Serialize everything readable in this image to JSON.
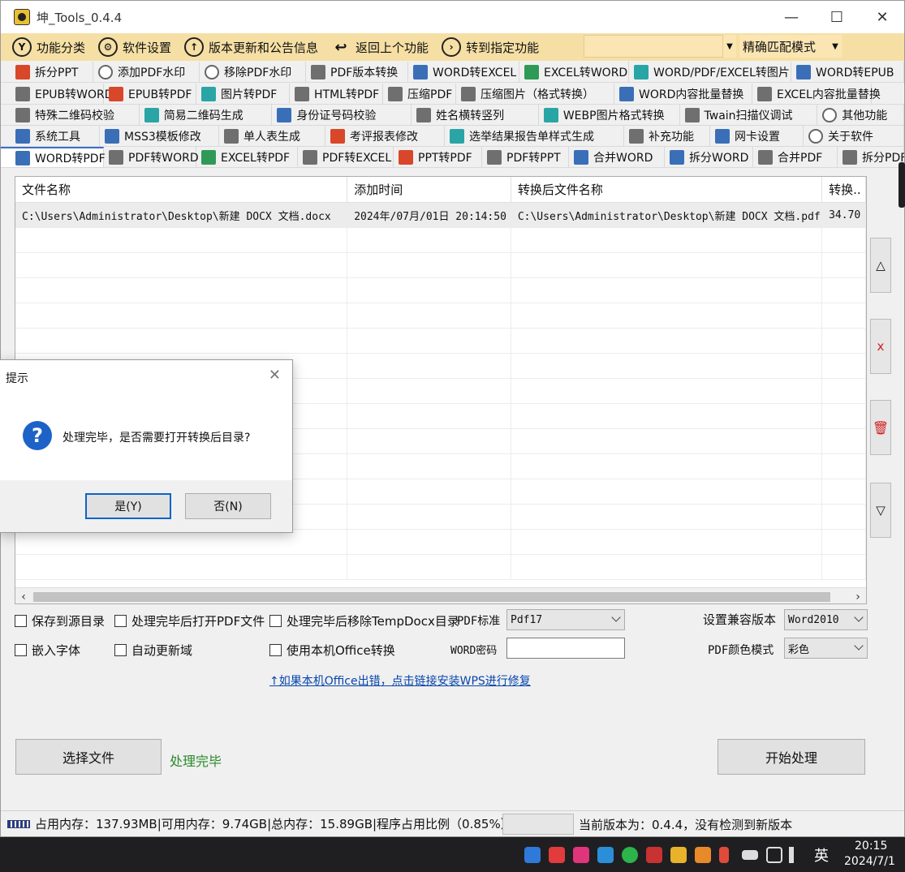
{
  "window": {
    "title": "坤_Tools_0.4.4",
    "minimize": "—",
    "maximize": "☐",
    "close": "✕"
  },
  "toolbar": {
    "items": [
      {
        "label": "功能分类",
        "icon": "Y"
      },
      {
        "label": "软件设置",
        "icon": "⚙"
      },
      {
        "label": "版本更新和公告信息",
        "icon": "↑"
      },
      {
        "label": "返回上个功能",
        "icon": "↩"
      },
      {
        "label": "转到指定功能",
        "icon": "›"
      }
    ],
    "search_value": "",
    "match_mode": "精确匹配模式"
  },
  "tab_rows": [
    [
      {
        "label": "拆分PPT",
        "icon": "ico-red"
      },
      {
        "label": "添加PDF水印",
        "icon": "ico-ring"
      },
      {
        "label": "移除PDF水印",
        "icon": "ico-ring"
      },
      {
        "label": "PDF版本转换",
        "icon": "ico-gray"
      },
      {
        "label": "WORD转EXCEL",
        "icon": "ico-blue"
      },
      {
        "label": "EXCEL转WORD",
        "icon": "ico-green"
      },
      {
        "label": "WORD/PDF/EXCEL转图片",
        "icon": "ico-teal"
      },
      {
        "label": "WORD转EPUB",
        "icon": "ico-blue"
      }
    ],
    [
      {
        "label": "EPUB转WORD",
        "icon": "ico-gray"
      },
      {
        "label": "EPUB转PDF",
        "icon": "ico-red"
      },
      {
        "label": "图片转PDF",
        "icon": "ico-teal"
      },
      {
        "label": "HTML转PDF",
        "icon": "ico-gray"
      },
      {
        "label": "压缩PDF",
        "icon": "ico-gray"
      },
      {
        "label": "压缩图片（格式转换）",
        "icon": "ico-gray"
      },
      {
        "label": "WORD内容批量替换",
        "icon": "ico-blue"
      },
      {
        "label": "EXCEL内容批量替换",
        "icon": "ico-gray"
      }
    ],
    [
      {
        "label": "特殊二维码校验",
        "icon": "ico-gray"
      },
      {
        "label": "简易二维码生成",
        "icon": "ico-teal"
      },
      {
        "label": "身份证号码校验",
        "icon": "ico-blue"
      },
      {
        "label": "姓名横转竖列",
        "icon": "ico-gray"
      },
      {
        "label": "WEBP图片格式转换",
        "icon": "ico-teal"
      },
      {
        "label": "Twain扫描仪调试",
        "icon": "ico-gray"
      },
      {
        "label": "其他功能",
        "icon": "ico-ring"
      }
    ],
    [
      {
        "label": "系统工具",
        "icon": "ico-blue"
      },
      {
        "label": "MSS3模板修改",
        "icon": "ico-blue"
      },
      {
        "label": "单人表生成",
        "icon": "ico-gray"
      },
      {
        "label": "考评报表修改",
        "icon": "ico-red"
      },
      {
        "label": "选举结果报告单样式生成",
        "icon": "ico-teal"
      },
      {
        "label": "补充功能",
        "icon": "ico-gray"
      },
      {
        "label": "网卡设置",
        "icon": "ico-blue"
      },
      {
        "label": "关于软件",
        "icon": "ico-ring"
      }
    ],
    [
      {
        "label": "WORD转PDF",
        "icon": "ico-blue"
      },
      {
        "label": "PDF转WORD",
        "icon": "ico-gray"
      },
      {
        "label": "EXCEL转PDF",
        "icon": "ico-green"
      },
      {
        "label": "PDF转EXCEL",
        "icon": "ico-gray"
      },
      {
        "label": "PPT转PDF",
        "icon": "ico-red"
      },
      {
        "label": "PDF转PPT",
        "icon": "ico-gray"
      },
      {
        "label": "合并WORD",
        "icon": "ico-blue"
      },
      {
        "label": "拆分WORD",
        "icon": "ico-blue"
      },
      {
        "label": "合并PDF",
        "icon": "ico-gray"
      },
      {
        "label": "拆分PDF",
        "icon": "ico-gray"
      }
    ]
  ],
  "grid": {
    "columns": [
      "文件名称",
      "添加时间",
      "转换后文件名称",
      "转换.."
    ],
    "rows": [
      [
        "C:\\Users\\Administrator\\Desktop\\新建 DOCX 文档.docx",
        "2024年/07月/01日 20:14:50",
        "C:\\Users\\Administrator\\Desktop\\新建 DOCX 文档.pdf",
        "34.70"
      ]
    ],
    "empty_rows": 14
  },
  "side_buttons": {
    "up": "△",
    "delete": "x",
    "clear": "🗑",
    "down": "▽"
  },
  "options": {
    "save_to_source": "保存到源目录",
    "open_pdf_after": "处理完毕后打开PDF文件",
    "remove_tempdocx": "处理完毕后移除TempDocx目录",
    "pdf_standard_label": "PDF标准",
    "pdf_standard_value": "Pdf17",
    "compat_label": "设置兼容版本",
    "compat_value": "Word2010",
    "embed_fonts": "嵌入字体",
    "auto_update_fields": "自动更新域",
    "use_local_office": "使用本机Office转换",
    "word_password_label": "WORD密码",
    "word_password_value": "",
    "pdf_color_label": "PDF颜色模式",
    "pdf_color_value": "彩色",
    "repair_link": "↑如果本机Office出错，点击链接安装WPS进行修复"
  },
  "actions": {
    "select_files": "选择文件",
    "status": "处理完毕",
    "start": "开始处理"
  },
  "statusbar": {
    "memory": "占用内存：137.93MB|可用内存：9.74GB|总内存：15.89GB|程序占用比例（0.85%）",
    "version": "当前版本为：0.4.4，没有检测到新版本"
  },
  "dialog": {
    "title": "提示",
    "close": "✕",
    "icon": "?",
    "message": "处理完毕，是否需要打开转换后目录?",
    "yes": "是(Y)",
    "no": "否(N)"
  },
  "taskbar": {
    "ime": "英",
    "time": "20:15",
    "date": "2024/7/1"
  },
  "colors": {
    "toolbar_bg": "#f6dfa4",
    "link": "#0645ad",
    "status_done": "#2a8a2a",
    "dialog_icon": "#1d62c7"
  }
}
